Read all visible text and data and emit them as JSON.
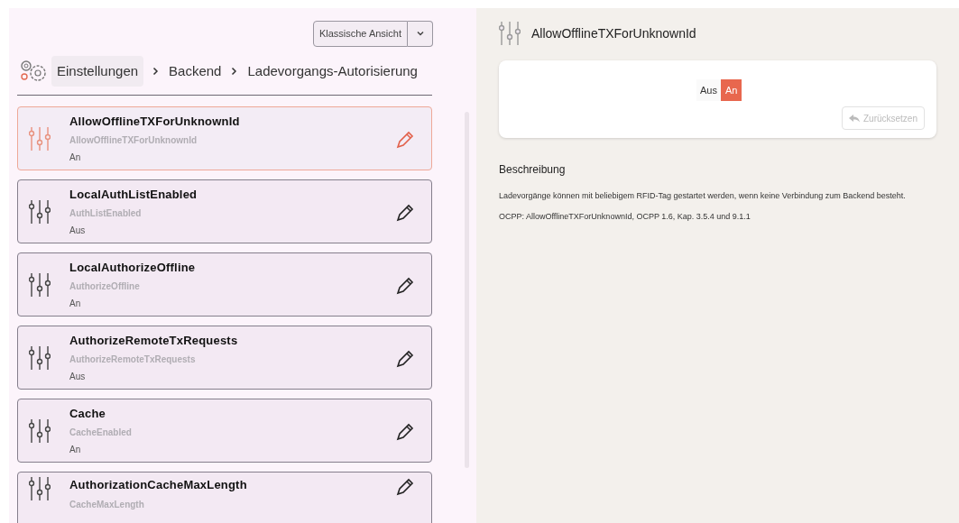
{
  "view_switch": {
    "label": "Klassische Ansicht"
  },
  "breadcrumb": [
    "Einstellungen",
    "Backend",
    "Ladevorgangs-Autorisierung"
  ],
  "settings": [
    {
      "title": "AllowOfflineTXForUnknownId",
      "key": "AllowOfflineTXForUnknownId",
      "value": "An",
      "selected": true
    },
    {
      "title": "LocalAuthListEnabled",
      "key": "AuthListEnabled",
      "value": "Aus",
      "selected": false
    },
    {
      "title": "LocalAuthorizeOffline",
      "key": "AuthorizeOffline",
      "value": "An",
      "selected": false
    },
    {
      "title": "AuthorizeRemoteTxRequests",
      "key": "AuthorizeRemoteTxRequests",
      "value": "Aus",
      "selected": false
    },
    {
      "title": "Cache",
      "key": "CacheEnabled",
      "value": "An",
      "selected": false
    },
    {
      "title": "AuthorizationCacheMaxLength",
      "key": "CacheMaxLength",
      "selected": false
    }
  ],
  "detail": {
    "title": "AllowOfflineTXForUnknownId",
    "toggle": [
      {
        "label": "Aus",
        "selected": false
      },
      {
        "label": "An",
        "selected": true
      }
    ],
    "reset_button": {
      "label": "Zurücksetzen",
      "disabled": true
    },
    "description_heading": "Beschreibung",
    "description": "Ladevorgänge können mit beliebigem RFID-Tag gestartet werden, wenn keine Verbindung zum Backend besteht.",
    "reference": "OCPP: AllowOfflineTXForUnknownId, OCPP 1.6, Kap. 3.5.4 und 9.1.1"
  }
}
